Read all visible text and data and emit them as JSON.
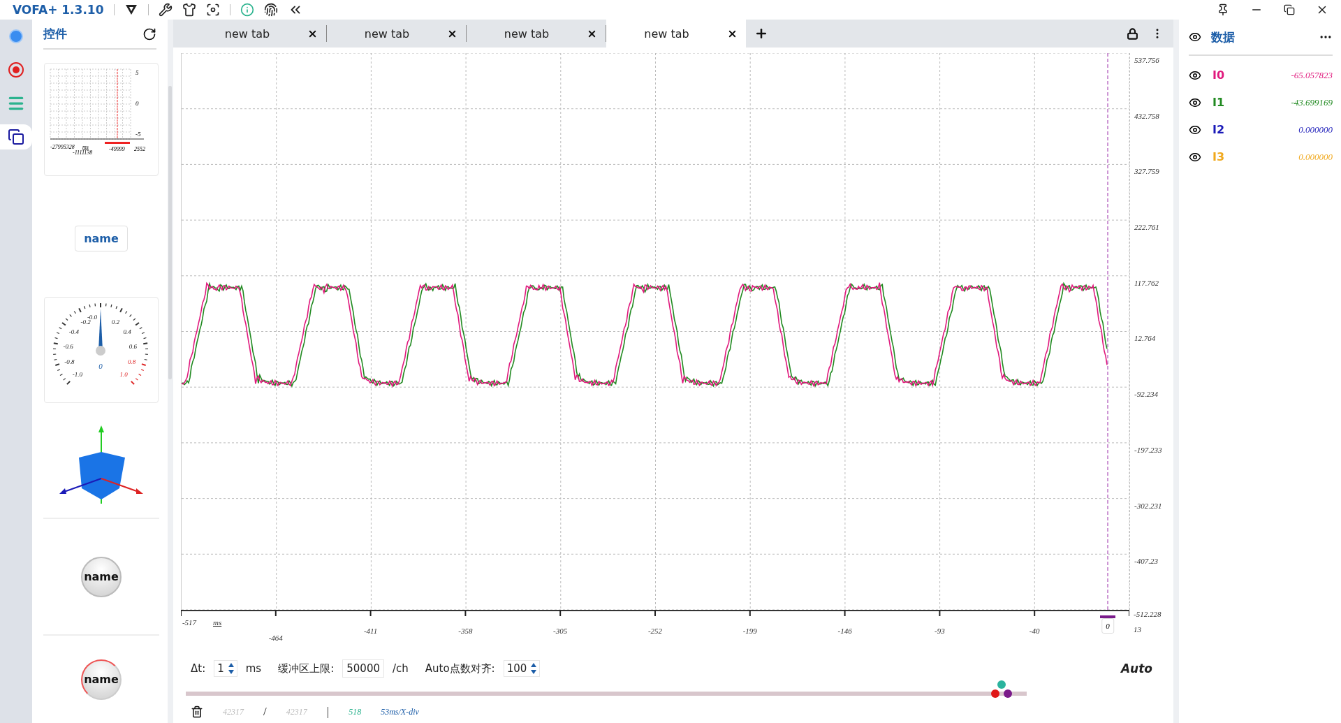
{
  "app": {
    "title": "VOFA+ 1.3.10"
  },
  "rail": [
    {
      "kind": "dot",
      "selected": false
    },
    {
      "kind": "record",
      "selected": false
    },
    {
      "kind": "list",
      "selected": false
    },
    {
      "kind": "windows",
      "selected": true
    }
  ],
  "widgets": {
    "title": "控件",
    "items": [
      {
        "kind": "mini_chart",
        "y_labels": [
          "5",
          "0",
          "-5"
        ],
        "x_labels": [
          "-27995328",
          "ms",
          "-1111138",
          "-49999",
          "2552"
        ]
      },
      {
        "kind": "button",
        "label": "name"
      },
      {
        "kind": "gauge",
        "labels": [
          "-1.0",
          "-0.8",
          "-0.6",
          "-0.4",
          "-0.2",
          "-0.0",
          "0.2",
          "0.4",
          "0.6",
          "0.8",
          "1.0"
        ],
        "center": "0"
      },
      {
        "kind": "cube"
      },
      {
        "kind": "round_button",
        "label": "name"
      },
      {
        "kind": "knob",
        "label": "name"
      }
    ]
  },
  "tabs": [
    {
      "label": "new tab",
      "selected": false
    },
    {
      "label": "new tab",
      "selected": false
    },
    {
      "label": "new tab",
      "selected": false
    },
    {
      "label": "new tab",
      "selected": true
    }
  ],
  "chart": {
    "y_labels": [
      "537.756",
      "432.758",
      "327.759",
      "222.761",
      "117.762",
      "12.764",
      "-92.234",
      "-197.233",
      "-302.231",
      "-407.23",
      "-512.228"
    ],
    "x_labels": [
      "-517",
      "-464",
      "-411",
      "-358",
      "-305",
      "-252",
      "-199",
      "-146",
      "-93",
      "-40",
      "13"
    ],
    "x_unit": "ms",
    "cursor_label": "0"
  },
  "controls": {
    "dt_label": "Δt:",
    "dt_value": "1",
    "dt_unit": "ms",
    "buffer_label": "缓冲区上限:",
    "buffer_value": "50000",
    "buffer_unit": "/ch",
    "align_label": "Auto点数对齐:",
    "align_value": "100",
    "mode": "Auto"
  },
  "slider": {
    "level": 0.97
  },
  "status": {
    "received": "42317",
    "separator": "/",
    "total": "42317",
    "divider": "|",
    "points": "518",
    "scale": "53ms/X-div"
  },
  "data_panel": {
    "title": "数据",
    "channels": [
      {
        "name": "I0",
        "value": "-65.057823",
        "color": "#e0197d"
      },
      {
        "name": "I1",
        "value": "-43.699169",
        "color": "#218a21"
      },
      {
        "name": "I2",
        "value": "0.000000",
        "color": "#1a1ab8"
      },
      {
        "name": "I3",
        "value": "0.000000",
        "color": "#f0a81c"
      }
    ]
  }
}
